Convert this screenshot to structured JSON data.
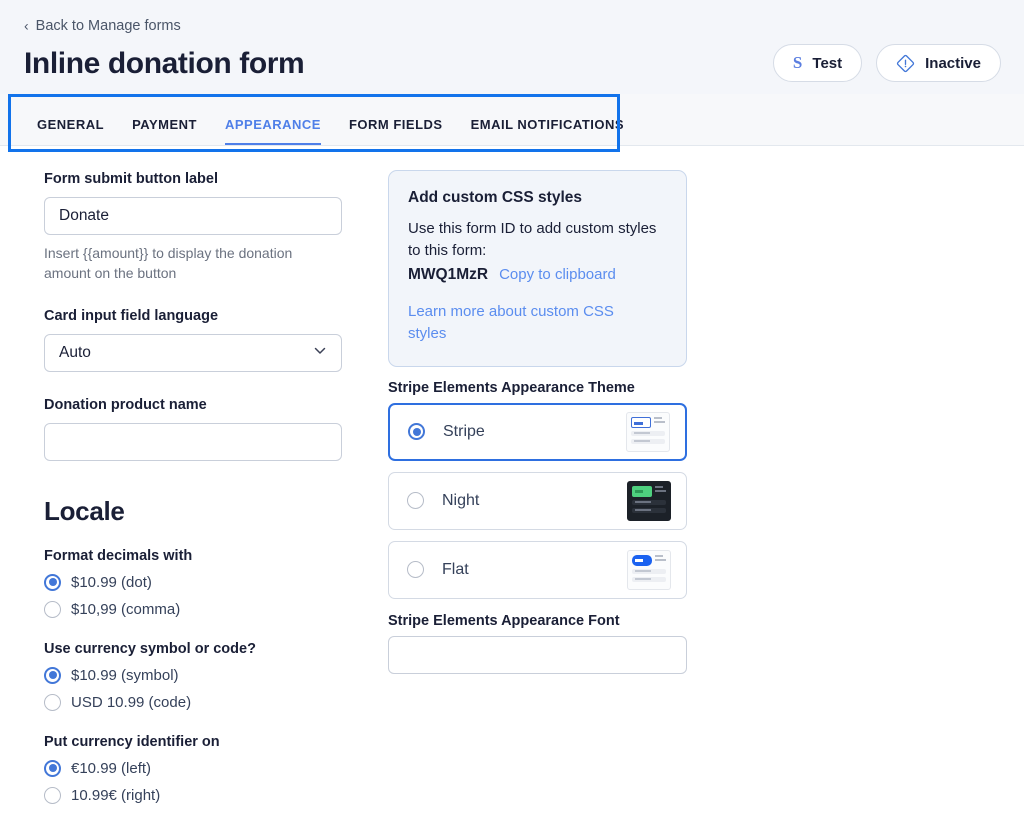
{
  "header": {
    "back_label": "Back to Manage forms",
    "back_icon": "chevron-left-icon",
    "title": "Inline donation form",
    "test_button": {
      "label": "Test",
      "icon": "stripe-s-icon"
    },
    "status_button": {
      "label": "Inactive",
      "icon": "alert-diamond-icon"
    }
  },
  "tabs": [
    {
      "label": "GENERAL",
      "active": false
    },
    {
      "label": "PAYMENT",
      "active": false
    },
    {
      "label": "APPEARANCE",
      "active": true
    },
    {
      "label": "FORM FIELDS",
      "active": false
    },
    {
      "label": "EMAIL NOTIFICATIONS",
      "active": false
    }
  ],
  "annotation": {
    "color": "#1273eb"
  },
  "left": {
    "submit_button": {
      "label": "Form submit button label",
      "value": "Donate",
      "placeholder": "",
      "helper": "Insert {{amount}} to display the donation amount on the button"
    },
    "card_language": {
      "label": "Card input field language",
      "value": "Auto",
      "chevron_icon": "chevron-down-icon"
    },
    "product_name": {
      "label": "Donation product name",
      "value": "",
      "placeholder": ""
    },
    "locale": {
      "title": "Locale",
      "groups": [
        {
          "label": "Format decimals with",
          "options": [
            {
              "text": "$10.99 (dot)",
              "selected": true
            },
            {
              "text": "$10,99 (comma)",
              "selected": false
            }
          ]
        },
        {
          "label": "Use currency symbol or code?",
          "options": [
            {
              "text": "$10.99 (symbol)",
              "selected": true
            },
            {
              "text": "USD 10.99 (code)",
              "selected": false
            }
          ]
        },
        {
          "label": "Put currency identifier on",
          "options": [
            {
              "text": "€10.99 (left)",
              "selected": true
            },
            {
              "text": "10.99€ (right)",
              "selected": false
            }
          ]
        }
      ]
    }
  },
  "right": {
    "css_card": {
      "title": "Add custom CSS styles",
      "body": "Use this form ID to add custom styles to this form:",
      "form_id": "MWQ1MzR",
      "copy_link": "Copy to clipboard",
      "learn_link": "Learn more about custom CSS styles"
    },
    "theme": {
      "label": "Stripe Elements Appearance Theme",
      "options": [
        {
          "name": "Stripe",
          "selected": true,
          "thumb": "stripe-theme-thumbnail"
        },
        {
          "name": "Night",
          "selected": false,
          "thumb": "night-theme-thumbnail"
        },
        {
          "name": "Flat",
          "selected": false,
          "thumb": "flat-theme-thumbnail"
        }
      ]
    },
    "font": {
      "label": "Stripe Elements Appearance Font",
      "value": "",
      "placeholder": ""
    }
  },
  "colors": {
    "accent": "#4f7fe8",
    "annotation": "#1273eb",
    "header_bg": "#f4f6fa",
    "card_bg": "#f2f5fa",
    "night_thumb": "#1c2128",
    "night_accent": "#4ed07f",
    "flat_accent": "#1b62f0"
  }
}
